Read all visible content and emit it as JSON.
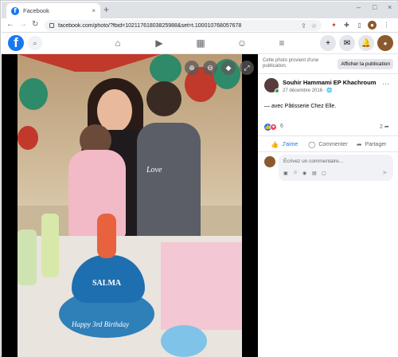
{
  "browser": {
    "tab_title": "Facebook",
    "tab_close": "×",
    "new_tab": "+",
    "url": "facebook.com/photo/?fbid=10211761803825988&set=t.100010768057678",
    "icons": [
      "back-icon",
      "forward-icon",
      "reload-icon",
      "lock-icon",
      "share-icon",
      "star-icon",
      "extension-icon",
      "sidebar-icon",
      "profile-icon",
      "menu-icon"
    ],
    "window_controls": [
      "–",
      "□",
      "×"
    ]
  },
  "fb_nav": {
    "logo": "f",
    "tabs": [
      "home-icon",
      "watch-icon",
      "marketplace-icon",
      "groups-icon",
      "menu-icon"
    ],
    "right_icons": [
      "create-icon",
      "messenger-icon",
      "notifications-icon",
      "account-icon"
    ]
  },
  "photo": {
    "cake_name": "SALMA",
    "cake_message": "Happy 3rd Birthday",
    "controls": [
      "zoom-in-icon",
      "zoom-out-icon",
      "tag-icon",
      "fullscreen-icon"
    ]
  },
  "panel": {
    "notice_text": "Cette photo provient d'une publication.",
    "view_post_label": "Afficher la publication",
    "poster_name": "Souhir Hammami EP Khachroum",
    "post_date": "27 décembre 2016 · 🌐",
    "more": "···",
    "caption": "— avec Pâtisserie Chez Elle.",
    "reaction_count": "6",
    "share_count": "2",
    "actions": {
      "like": "J'aime",
      "comment": "Commenter",
      "share": "Partager"
    },
    "comment_placeholder": "Écrivez un commentaire..."
  },
  "colors": {
    "facebook_blue": "#1877f2",
    "love_red": "#f33e58",
    "online_green": "#31a24c",
    "secondary_text": "#65676b"
  }
}
